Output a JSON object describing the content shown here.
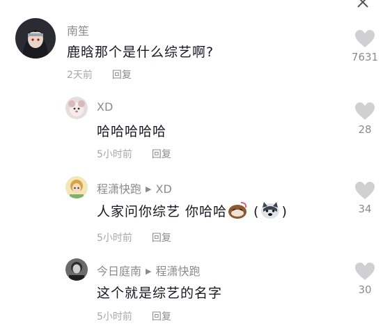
{
  "comments": [
    {
      "username": "南笙",
      "text": "鹿晗那个是什么综艺啊?",
      "time": "2天前",
      "reply_label": "回复",
      "likes": "7631"
    }
  ],
  "replies": [
    {
      "username": "XD",
      "text": "哈哈哈哈哈",
      "time": "5小时前",
      "reply_label": "回复",
      "likes": "28"
    },
    {
      "username": "程潇快跑",
      "reply_to": "XD",
      "text": "人家问你综艺 你哈哈",
      "text_suffix_open": "(",
      "text_suffix_close": ")",
      "time": "5小时前",
      "reply_label": "回复",
      "likes": "34"
    },
    {
      "username": "今日庭南",
      "reply_to": "程潇快跑",
      "text": "这个就是综艺的名字",
      "time": "5小时前",
      "reply_label": "回复",
      "likes": "30"
    }
  ],
  "colors": {
    "text": "#161823",
    "secondary": "#8a8b91",
    "heart": "#d0d0d3"
  },
  "icons": {
    "close": "close-icon",
    "like": "heart-icon",
    "reply_arrow": "triangle-right-icon"
  }
}
